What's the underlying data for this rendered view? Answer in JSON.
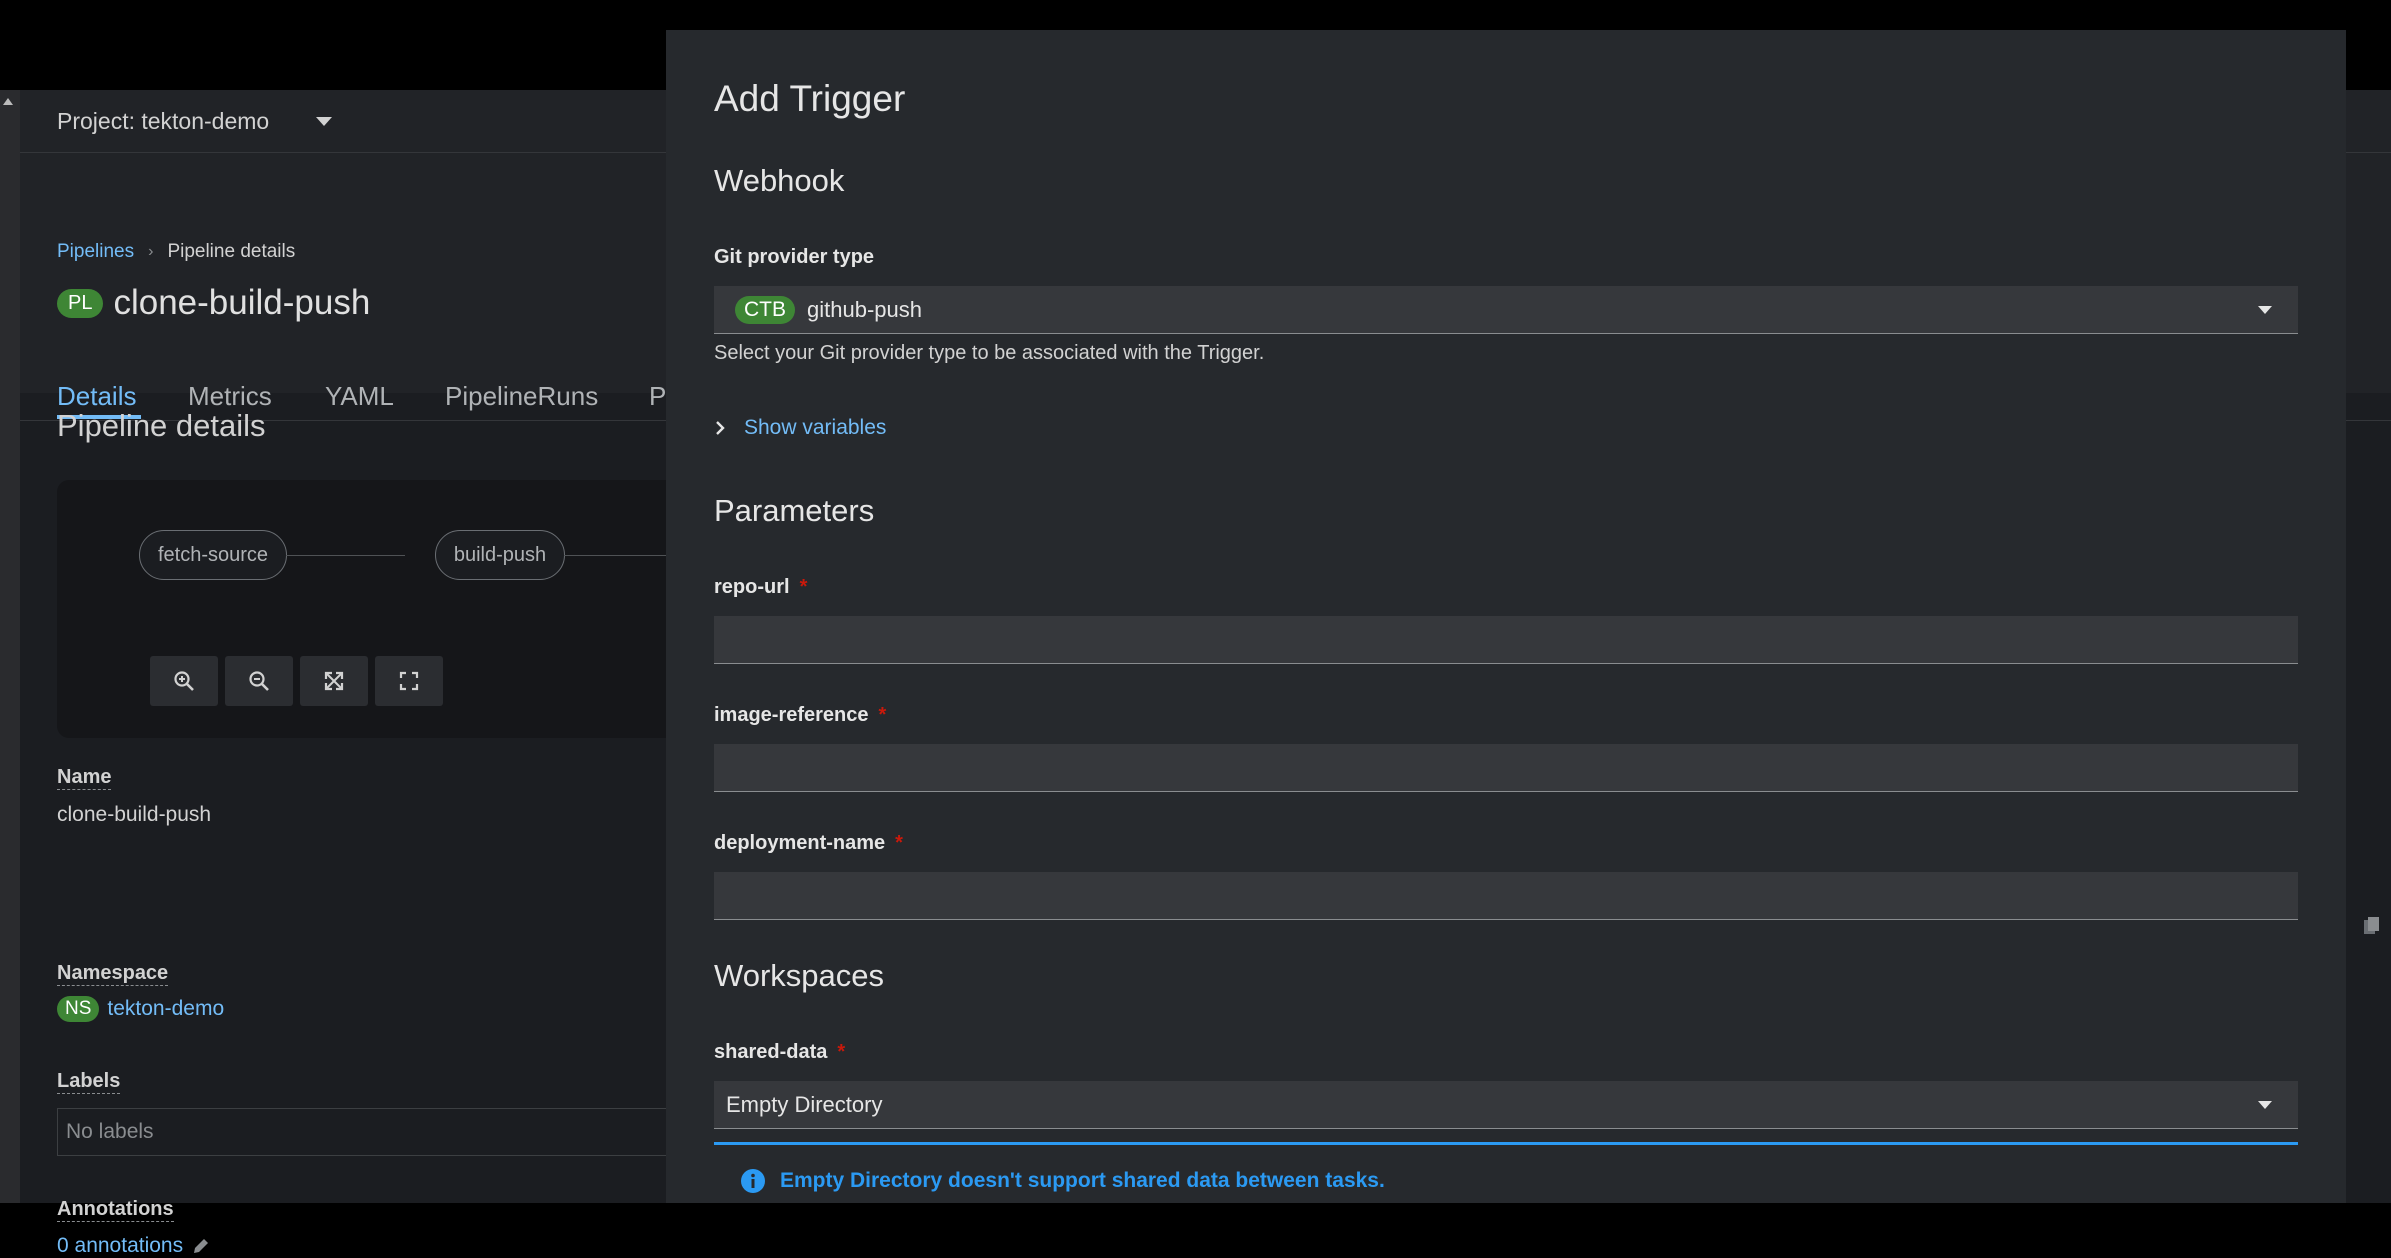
{
  "project": {
    "label": "Project: tekton-demo"
  },
  "breadcrumb": {
    "pipelines": "Pipelines",
    "current": "Pipeline details"
  },
  "pipeline": {
    "badge": "PL",
    "name": "clone-build-push"
  },
  "tabs": [
    {
      "label": "Details",
      "active": true
    },
    {
      "label": "Metrics"
    },
    {
      "label": "YAML"
    },
    {
      "label": "PipelineRuns"
    },
    {
      "label": "P"
    }
  ],
  "details": {
    "section_title": "Pipeline details",
    "topology": {
      "nodes": [
        "fetch-source",
        "build-push"
      ]
    },
    "name_label": "Name",
    "name_value": "clone-build-push",
    "namespace_label": "Namespace",
    "namespace_badge": "NS",
    "namespace_value": "tekton-demo",
    "labels_label": "Labels",
    "labels_value": "No labels",
    "annotations_label": "Annotations",
    "annotations_link": "0 annotations"
  },
  "modal": {
    "title": "Add Trigger",
    "webhook_heading": "Webhook",
    "git_provider_label": "Git provider type",
    "git_provider_badge": "CTB",
    "git_provider_value": "github-push",
    "git_provider_helper": "Select your Git provider type to be associated with the Trigger.",
    "show_variables": "Show variables",
    "parameters_heading": "Parameters",
    "params": [
      {
        "label": "repo-url",
        "required": "*",
        "value": ""
      },
      {
        "label": "image-reference",
        "required": "*",
        "value": ""
      },
      {
        "label": "deployment-name",
        "required": "*",
        "value": ""
      }
    ],
    "workspaces_heading": "Workspaces",
    "workspace_label": "shared-data",
    "workspace_required": "*",
    "workspace_value": "Empty Directory",
    "alert": "Empty Directory doesn't support shared data between tasks."
  },
  "colors": {
    "accent": "#73bcf7",
    "badge_green": "#3e8635",
    "required": "#c9190b",
    "info": "#2b9af3"
  }
}
